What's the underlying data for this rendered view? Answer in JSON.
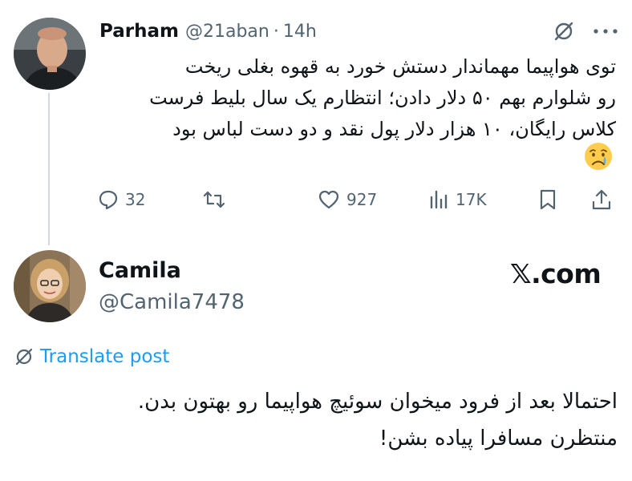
{
  "post1": {
    "author_name": "Parham",
    "handle": "@21aban",
    "separator": "·",
    "time": "14h",
    "text_lines": [
      "توی هواپیما مهماندار دستش خورد به قهوه بغلی ریخت",
      "رو شلوارم بهم ۵۰ دلار دادن؛ انتظارم یک سال بلیط فرست",
      "کلاس رایگان، ۱۰ هزار دلار پول نقد و دو دست لباس بود"
    ],
    "emoji": "crying-face",
    "actions": {
      "replies": "32",
      "reposts": "",
      "likes": "927",
      "views": "17K"
    }
  },
  "post2": {
    "author_name": "Camila",
    "handle": "@Camila7478",
    "watermark": "𝕏.com",
    "translate_label": "Translate post",
    "text_lines": [
      "احتمالا بعد از فرود میخوان سوئیچ هواپیما رو بهتون بدن.",
      "منتظرن مسافرا پیاده بشن!"
    ]
  },
  "colors": {
    "text": "#0f1419",
    "secondary": "#536471",
    "accent": "#1d9bf0",
    "thread_line": "#cfd9de"
  }
}
